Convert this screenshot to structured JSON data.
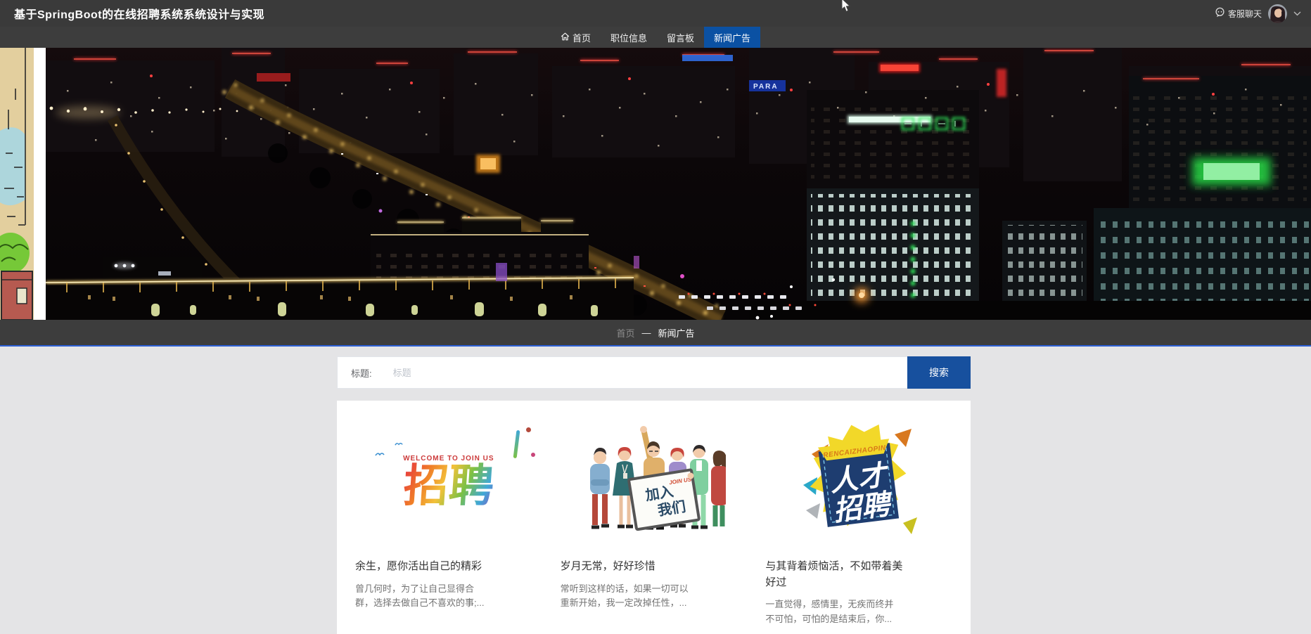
{
  "header": {
    "title": "基于SpringBoot的在线招聘系统系统设计与实现",
    "service_chat": "客服聊天"
  },
  "nav": {
    "items": [
      {
        "label": "首页",
        "active": false
      },
      {
        "label": "职位信息",
        "active": false
      },
      {
        "label": "留言板",
        "active": false
      },
      {
        "label": "新闻广告",
        "active": true
      }
    ]
  },
  "breadcrumb": {
    "home": "首页",
    "separator": "—",
    "current": "新闻广告"
  },
  "search": {
    "label": "标题:",
    "placeholder": "标题",
    "button": "搜索"
  },
  "cards": [
    {
      "caption": "WELCOME TO JOIN US",
      "main": "招聘",
      "title": "余生，愿你活出自己的精彩",
      "excerpt": "曾几何时，为了让自己显得合群，选择去做自己不喜欢的事;..."
    },
    {
      "sign_line1": "加入",
      "sign_line2": "我们",
      "sign_sub": "JOIN US",
      "title": "岁月无常，好好珍惜",
      "excerpt": "常听到这样的话，如果一切可以重新开始，我一定改掉任性，..."
    },
    {
      "ribbon": "RENCAIZHAOPIN",
      "main_line1": "人才",
      "main_line2": "招聘",
      "title": "与其背着烦恼活，不如带着美好过",
      "excerpt": "一直觉得，感情里，无疾而终并不可怕，可怕的是结束后，你..."
    }
  ],
  "colors": {
    "accent_blue": "#0b51a3",
    "button_blue": "#17509e",
    "breadcrumb_line": "#2c5fd4",
    "topbar_bg": "#3a3a3a",
    "navbar_bg": "#3d3d3d",
    "page_bg": "#e4e4e6"
  }
}
